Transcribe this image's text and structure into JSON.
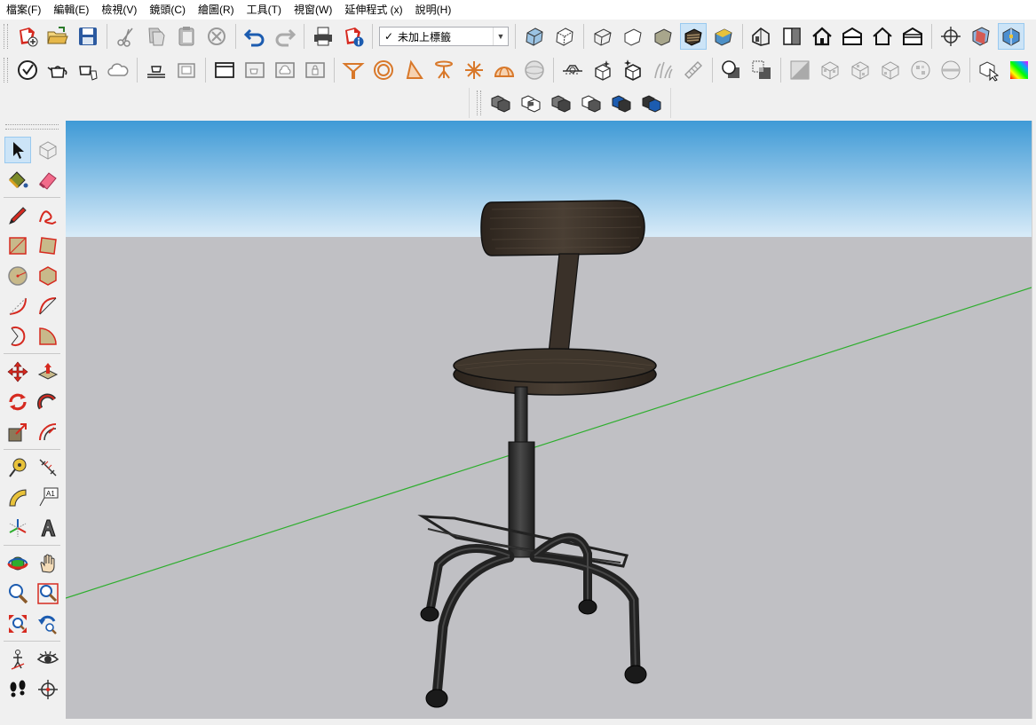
{
  "menu": [
    "檔案(F)",
    "編輯(E)",
    "檢視(V)",
    "鏡頭(C)",
    "繪圖(R)",
    "工具(T)",
    "視窗(W)",
    "延伸程式 (x)",
    "說明(H)"
  ],
  "tag_selector": {
    "check": "✓",
    "value": "未加上標籤"
  },
  "left_toolbar": {
    "text_tool_label": "A1"
  },
  "toolbar1_icons": [
    "new-file",
    "open-file",
    "save",
    "cut",
    "copy",
    "paste",
    "erase",
    "undo",
    "redo",
    "print",
    "model-info"
  ],
  "toolbar1_views": [
    "xray",
    "back-edges",
    "wireframe",
    "hidden-line",
    "shaded",
    "shaded-with-textures",
    "monochrome",
    "iso-view",
    "top-view",
    "front-view",
    "right-view",
    "back-view",
    "left-view",
    "position-camera",
    "section-plane",
    "display-sections"
  ],
  "colors": {
    "sky_top": "#3f9ad6",
    "sky_bottom": "#d8ebf8",
    "ground": "#c0c0c4",
    "axis_green": "#2eae2e",
    "wood": "#3a3129",
    "metal": "#2e2e2e",
    "accent_red": "#d62a20"
  }
}
